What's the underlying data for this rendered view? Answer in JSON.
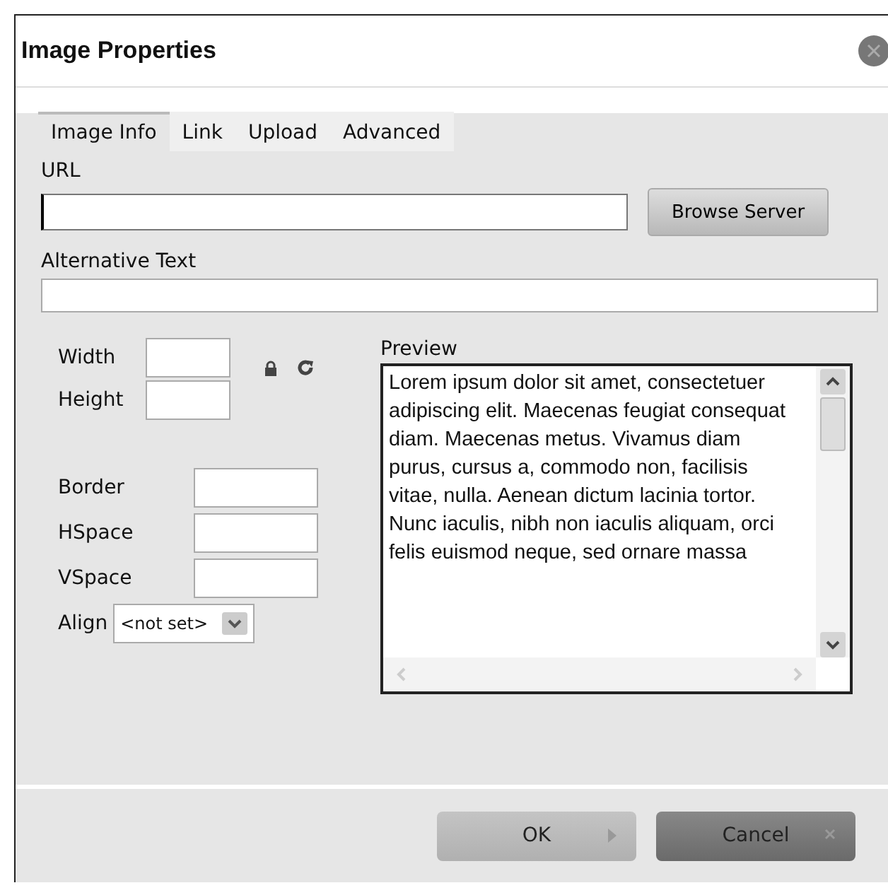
{
  "window": {
    "title": "Image Properties"
  },
  "tabs": [
    {
      "label": "Image Info",
      "selected": true
    },
    {
      "label": "Link",
      "selected": false
    },
    {
      "label": "Upload",
      "selected": false
    },
    {
      "label": "Advanced",
      "selected": false
    }
  ],
  "url": {
    "label": "URL",
    "focused": true
  },
  "browse_button": "Browse Server",
  "alt_text": {
    "label": "Alternative Text"
  },
  "size_fields": [
    {
      "label": "Width"
    },
    {
      "label": "Height"
    }
  ],
  "spacing_fields": [
    {
      "label": "Border"
    },
    {
      "label": "HSpace"
    },
    {
      "label": "VSpace"
    }
  ],
  "align": {
    "label": "Align",
    "value": "<not set>"
  },
  "preview": {
    "label": "Preview",
    "text": "Lorem ipsum dolor sit amet, consectetuer adipiscing elit. Maecenas feugiat consequat diam. Maecenas metus. Vivamus diam purus, cursus a, commodo non, facilisis vitae, nulla. Aenean dictum lacinia tortor. Nunc iaculis, nibh non iaculis aliquam, orci felis euismod neque, sed ornare massa"
  },
  "buttons": [
    {
      "label": "OK",
      "kind": "ok"
    },
    {
      "label": "Cancel",
      "kind": "cancel"
    }
  ]
}
